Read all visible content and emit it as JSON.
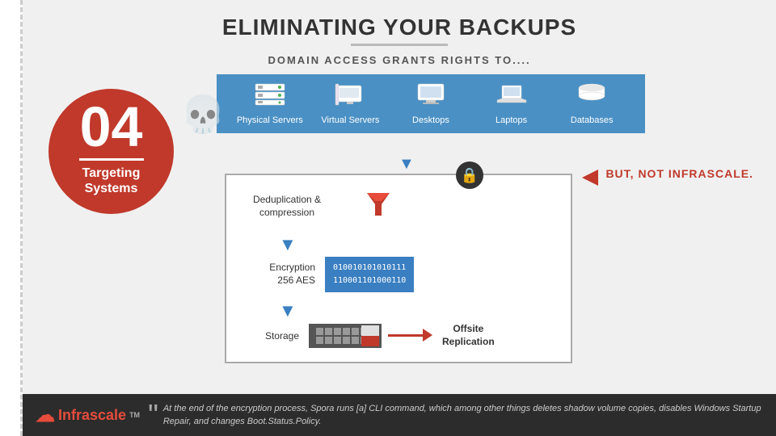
{
  "page": {
    "title": "ELIMINATING YOUR BACKUPS",
    "subtitle": "DOMAIN ACCESS GRANTS RIGHTS TO....",
    "left_strip_color": "#e0e0e0"
  },
  "domain_items": [
    {
      "id": "physical-servers",
      "label": "Physical Servers",
      "icon": "🖥"
    },
    {
      "id": "virtual-servers",
      "label": "Virtual Servers",
      "icon": "💻"
    },
    {
      "id": "desktops",
      "label": "Desktops",
      "icon": "🖥"
    },
    {
      "id": "laptops",
      "label": "Laptops",
      "icon": "💻"
    },
    {
      "id": "databases",
      "label": "Databases",
      "icon": "🗄"
    }
  ],
  "slide_number": {
    "number": "04",
    "label_line1": "Targeting",
    "label_line2": "Systems"
  },
  "but_not_text": "BUT, NOT INFRASCALE.",
  "process": {
    "dedup_label_line1": "Deduplication &",
    "dedup_label_line2": "compression",
    "encrypt_label_line1": "Encryption",
    "encrypt_label_line2": "256 AES",
    "binary_line1": "010010101010111",
    "binary_line2": "110001101000110",
    "storage_label": "Storage",
    "offsite_label_line1": "Offsite",
    "offsite_label_line2": "Replication"
  },
  "footer": {
    "logo_text": "Infrascale",
    "quote_text": "At the end of the encryption process, Spora runs [a] CLI command, which among other things deletes shadow volume copies, disables Windows Startup Repair, and changes Boot.Status.Policy."
  }
}
